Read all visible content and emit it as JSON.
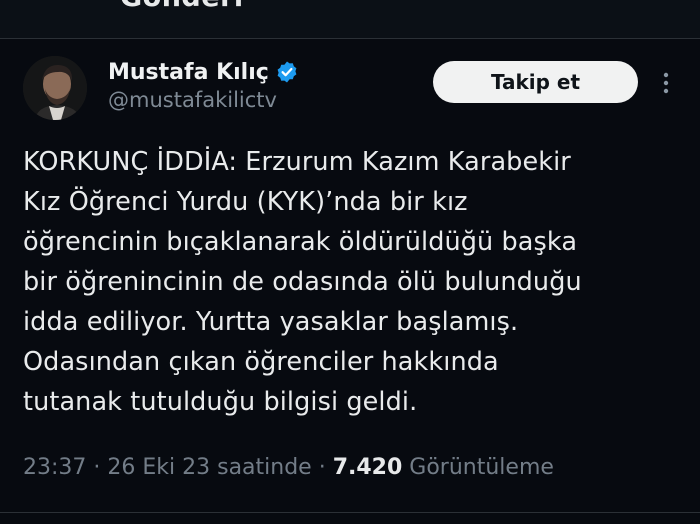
{
  "header": {
    "title": "Gönderi"
  },
  "author": {
    "name": "Mustafa Kılıç",
    "handle": "@mustafakilictv",
    "verified_color": "#1d9bf0"
  },
  "actions": {
    "follow_label": "Takip et",
    "more_icon": "more-vertical-icon"
  },
  "tweet": {
    "text": "KORKUNÇ İDDİA: Erzurum Kazım Karabekir\nKız Öğrenci Yurdu (KYK)’nda bir kız\nöğrencinin bıçaklanarak öldürüldüğü başka\nbir öğrenincinin de odasında ölü bulunduğu\nidda ediliyor. Yurtta yasaklar başlamış.\nOdasından çıkan öğrenciler hakkında\ntutanak tutulduğu bilgisi geldi."
  },
  "meta": {
    "time": "23:37",
    "separator": " · ",
    "date": "26 Eki 23 saatinde",
    "views_count": "7.420",
    "views_label": "Görüntüleme"
  },
  "colors": {
    "background": "#070a10",
    "text": "#e7e9ea",
    "muted": "#737d88",
    "follow_bg": "#f1f2f2"
  }
}
